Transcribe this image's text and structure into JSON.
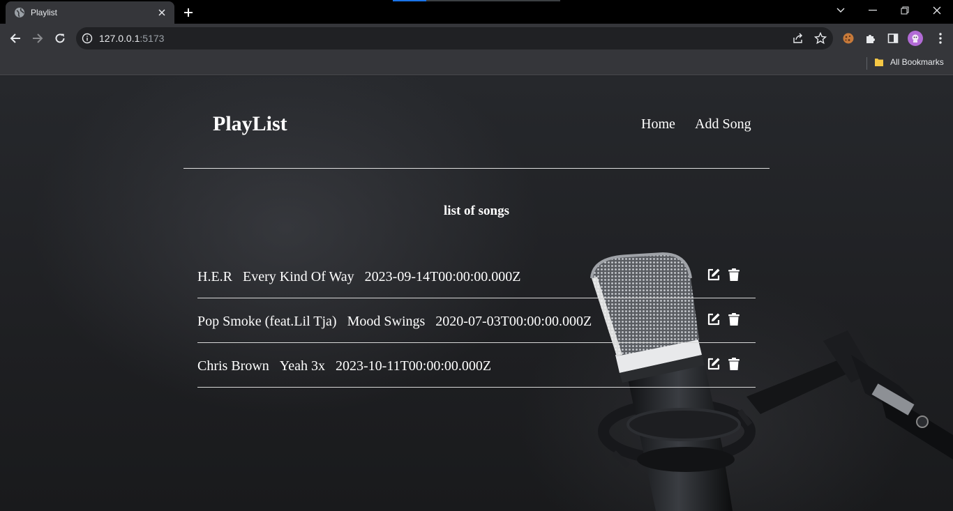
{
  "browser": {
    "tab_title": "Playlist",
    "url_host": "127.0.0.1",
    "url_port": ":5173",
    "bookmarks_label": "All Bookmarks"
  },
  "app": {
    "title": "PlayList",
    "nav": [
      {
        "label": "Home"
      },
      {
        "label": "Add Song"
      }
    ],
    "list_heading": "list of songs",
    "songs": [
      {
        "artist": "H.E.R",
        "title": "Every Kind Of Way",
        "date": "2023-09-14T00:00:00.000Z"
      },
      {
        "artist": "Pop Smoke (feat.Lil Tja)",
        "title": "Mood Swings",
        "date": "2020-07-03T00:00:00.000Z"
      },
      {
        "artist": "Chris Brown",
        "title": "Yeah 3x",
        "date": "2023-10-11T00:00:00.000Z"
      }
    ]
  },
  "icons": {
    "tab_favicon": "globe-icon",
    "edit": "pen-to-square-icon",
    "delete": "trash-icon"
  },
  "colors": {
    "text": "#ffffff",
    "browser_frame": "#35363a",
    "page_background": "#202124",
    "avatar": "#b26bd6"
  }
}
